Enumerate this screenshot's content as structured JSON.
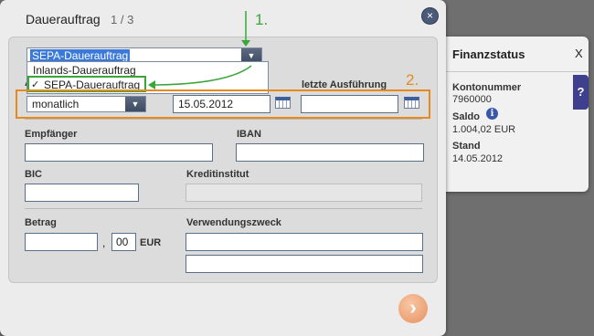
{
  "dialog": {
    "title": "Dauerauftrag",
    "step": "1 / 3",
    "close_icon": "×"
  },
  "order_type": {
    "selected": "SEPA-Dauerauftrag",
    "options": [
      "Inlands-Dauerauftrag",
      "SEPA-Dauerauftrag"
    ],
    "check_mark": "✓"
  },
  "schedule": {
    "interval_value": "monatlich",
    "first_date_value": "15.05.2012",
    "last_execution_label": "letzte Ausführung",
    "last_execution_value": "",
    "partial_label": "A"
  },
  "form": {
    "recipient_label": "Empfänger",
    "recipient_value": "",
    "iban_label": "IBAN",
    "iban_value": "",
    "bic_label": "BIC",
    "bic_value": "",
    "bank_label": "Kreditinstitut",
    "bank_value": "",
    "amount_label": "Betrag",
    "amount_value": "",
    "amount_sep": ",",
    "amount_cents": "00",
    "currency": "EUR",
    "purpose_label": "Verwendungszweck",
    "purpose_line1": "",
    "purpose_line2": ""
  },
  "next_button": {
    "icon": "›"
  },
  "finance": {
    "title": "Finanzstatus",
    "close": "X",
    "account_label": "Kontonummer",
    "account_value": "7960000",
    "balance_label": "Saldo",
    "balance_value": "1.004,02 EUR",
    "status_label": "Stand",
    "status_value": "14.05.2012",
    "info_icon": "i",
    "help_label": "?"
  },
  "annotations": {
    "step1": "1.",
    "step2": "2.",
    "green": "#3aa63a",
    "orange": "#e68a1e"
  }
}
